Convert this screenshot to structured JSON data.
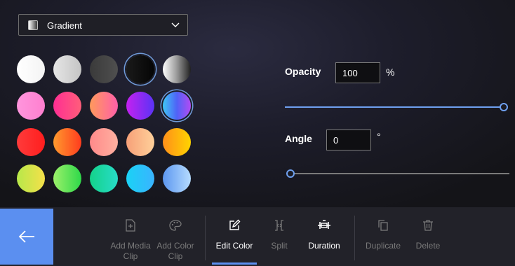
{
  "dropdown": {
    "label": "Gradient",
    "icon": "gradient-swatch-icon"
  },
  "swatches": [
    {
      "id": "white",
      "gradient": "linear-gradient(90deg,#ffffff,#f4f4f4)",
      "selected": false
    },
    {
      "id": "light-gray",
      "gradient": "linear-gradient(90deg,#e6e6e6,#c4c4c4)",
      "selected": false
    },
    {
      "id": "dark-gray",
      "gradient": "linear-gradient(90deg,#3a3a3a,#4f4f4f)",
      "selected": false
    },
    {
      "id": "black",
      "gradient": "linear-gradient(90deg,#1a1a1a,#050505)",
      "selected": true
    },
    {
      "id": "gray-fade",
      "gradient": "linear-gradient(90deg,#ffffff,#9a9a9a,#202020)",
      "selected": false
    },
    {
      "id": "pink",
      "gradient": "linear-gradient(90deg,#ff96dd,#ff7fcf)",
      "selected": false
    },
    {
      "id": "magenta",
      "gradient": "linear-gradient(90deg,#ff2e93,#ff5e7a)",
      "selected": false
    },
    {
      "id": "peach-pink",
      "gradient": "linear-gradient(90deg,#ff9a5c,#ff5fa8)",
      "selected": false
    },
    {
      "id": "purple",
      "gradient": "linear-gradient(90deg,#c421f0,#5a33f5)",
      "selected": false
    },
    {
      "id": "blue-purple",
      "gradient": "linear-gradient(90deg,#3fc7f5,#4f63f6,#b24bf3)",
      "selected": true
    },
    {
      "id": "red",
      "gradient": "linear-gradient(90deg,#ff3b3b,#ff1e1e)",
      "selected": false
    },
    {
      "id": "orange-red",
      "gradient": "linear-gradient(90deg,#ff9a2e,#ff3c1e)",
      "selected": false
    },
    {
      "id": "salmon",
      "gradient": "linear-gradient(90deg,#ff8a8a,#ffb0a0)",
      "selected": false
    },
    {
      "id": "apricot",
      "gradient": "linear-gradient(90deg,#f7a078,#ffd09a)",
      "selected": false
    },
    {
      "id": "gold",
      "gradient": "linear-gradient(90deg,#ff8f1a,#ffd400)",
      "selected": false
    },
    {
      "id": "lime-yellow",
      "gradient": "linear-gradient(90deg,#b7e84a,#f5e04a)",
      "selected": false
    },
    {
      "id": "green",
      "gradient": "linear-gradient(90deg,#9cf06a,#2ed84a)",
      "selected": false
    },
    {
      "id": "teal",
      "gradient": "linear-gradient(90deg,#14d28a,#28dcc8)",
      "selected": false
    },
    {
      "id": "sky",
      "gradient": "linear-gradient(90deg,#1ad2f5,#3ab4ff)",
      "selected": false
    },
    {
      "id": "light-blue",
      "gradient": "linear-gradient(90deg,#5c97f0,#b6dcff)",
      "selected": false
    }
  ],
  "opacity": {
    "label": "Opacity",
    "value": "100",
    "unit": "%",
    "level": 1.0
  },
  "angle": {
    "label": "Angle",
    "value": "0",
    "unit": "°",
    "level": 0.0
  },
  "toolbar": {
    "back_icon": "arrow-left-icon",
    "items": [
      {
        "key": "add-media-clip",
        "line1": "Add Media",
        "line2": "Clip",
        "icon": "add-media-icon",
        "enabled": false
      },
      {
        "key": "add-color-clip",
        "line1": "Add Color",
        "line2": "Clip",
        "icon": "palette-icon",
        "enabled": false
      },
      {
        "key": "edit-color",
        "line1": "Edit Color",
        "line2": "",
        "icon": "edit-icon",
        "enabled": true,
        "active": true
      },
      {
        "key": "split",
        "line1": "Split",
        "line2": "",
        "icon": "split-icon",
        "enabled": false
      },
      {
        "key": "duration",
        "line1": "Duration",
        "line2": "",
        "icon": "duration-icon",
        "enabled": true
      },
      {
        "key": "duplicate",
        "line1": "Duplicate",
        "line2": "",
        "icon": "duplicate-icon",
        "enabled": false
      },
      {
        "key": "delete",
        "line1": "Delete",
        "line2": "",
        "icon": "trash-icon",
        "enabled": false
      }
    ]
  },
  "colors": {
    "accent": "#5b8ff0",
    "slider_track": "#6fa0f0",
    "slider_track_empty": "#7a7a7a"
  }
}
